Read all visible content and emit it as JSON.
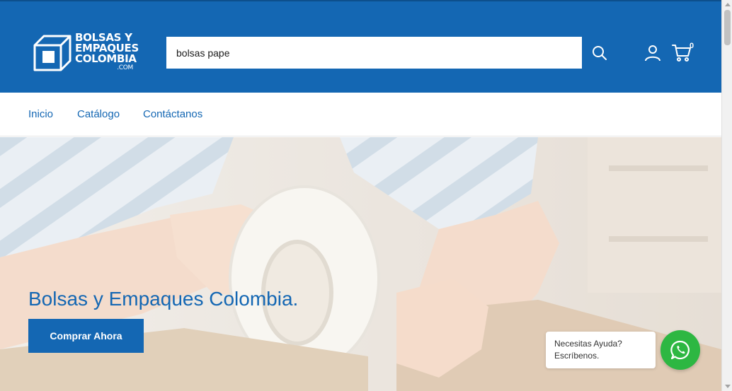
{
  "header": {
    "logo": {
      "line1": "BOLSAS Y",
      "line2": "EMPAQUES",
      "line3": "COLOMBIA",
      "line4": ".COM"
    },
    "search": {
      "value": "bolsas pape",
      "icon": "search-icon"
    },
    "account_icon": "user-icon",
    "cart": {
      "icon": "cart-icon",
      "count": "0"
    }
  },
  "nav": {
    "items": [
      {
        "label": "Inicio"
      },
      {
        "label": "Catálogo"
      },
      {
        "label": "Contáctanos"
      }
    ]
  },
  "hero": {
    "title": "Bolsas y Empaques Colombia.",
    "cta_label": "Comprar Ahora"
  },
  "whatsapp": {
    "line1": "Necesitas Ayuda?",
    "line2": "Escríbenos.",
    "icon": "whatsapp-icon"
  },
  "colors": {
    "brand_blue": "#1467b3",
    "whatsapp_green": "#2db742"
  }
}
